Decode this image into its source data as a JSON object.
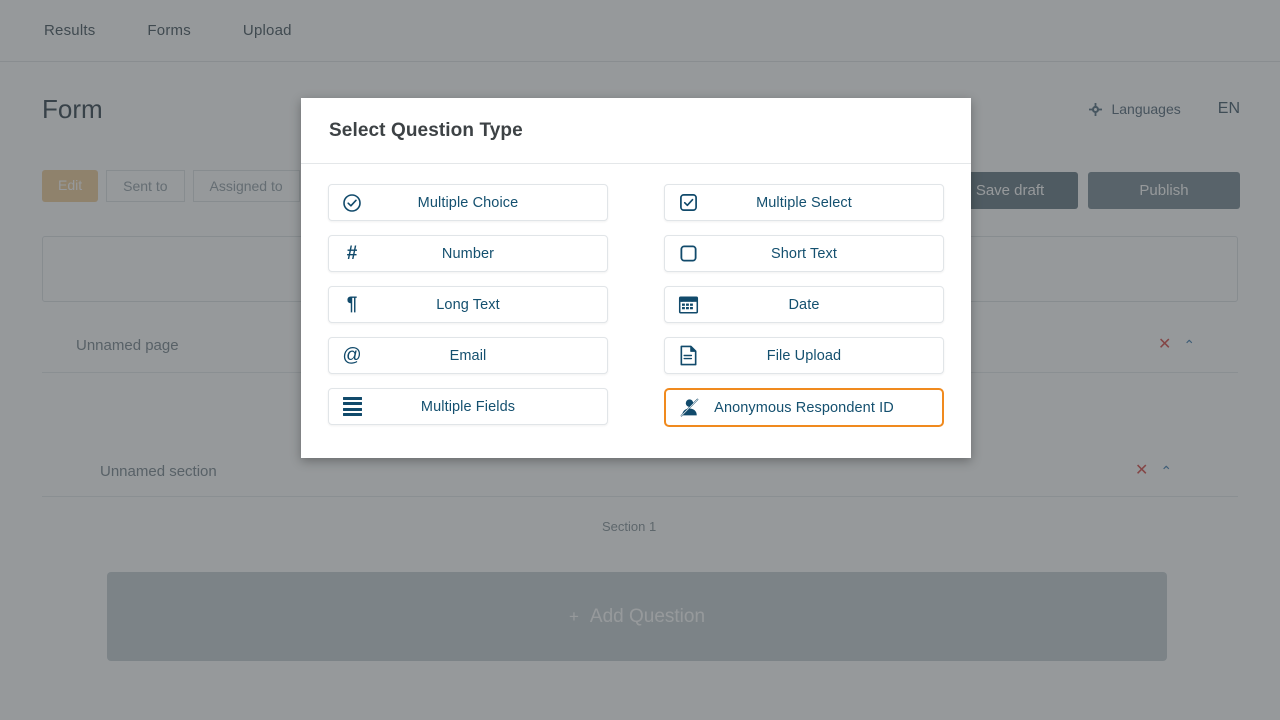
{
  "background": {
    "nav": [
      {
        "label": "Results",
        "name": "nav-results"
      },
      {
        "label": "Forms",
        "name": "nav-forms"
      },
      {
        "label": "Upload",
        "name": "nav-upload"
      }
    ],
    "form_title": "Form",
    "languages_label": "Languages",
    "language_code": "EN",
    "subtabs": [
      {
        "label": "Edit",
        "active": true
      },
      {
        "label": "Sent to",
        "active": false
      },
      {
        "label": "Assigned to",
        "active": false
      }
    ],
    "save_draft_label": "Save draft",
    "publish_label": "Publish",
    "page_label": "Unnamed page",
    "section_label": "Unnamed section",
    "section_marker": "Section 1",
    "add_question_label": "Add Question",
    "add_question_plus": "+",
    "row_icons": {
      "delete": "✕",
      "collapse": "⌃"
    }
  },
  "modal": {
    "title": "Select Question Type",
    "accent_color": "#f08a1e",
    "text_color": "#14506f",
    "left_column": [
      {
        "label": "Multiple Choice",
        "icon": "circle-check-icon",
        "selected": false
      },
      {
        "label": "Number",
        "icon": "hash-icon",
        "selected": false
      },
      {
        "label": "Long Text",
        "icon": "paragraph-icon",
        "selected": false
      },
      {
        "label": "Email",
        "icon": "at-sign-icon",
        "selected": false
      },
      {
        "label": "Multiple Fields",
        "icon": "list-bars-icon",
        "selected": false
      }
    ],
    "right_column": [
      {
        "label": "Multiple Select",
        "icon": "checkbox-checked-icon",
        "selected": false
      },
      {
        "label": "Short Text",
        "icon": "square-empty-icon",
        "selected": false
      },
      {
        "label": "Date",
        "icon": "calendar-icon",
        "selected": false
      },
      {
        "label": "File Upload",
        "icon": "document-icon",
        "selected": false
      },
      {
        "label": "Anonymous Respondent ID",
        "icon": "anonymous-user-icon",
        "selected": true
      }
    ]
  }
}
